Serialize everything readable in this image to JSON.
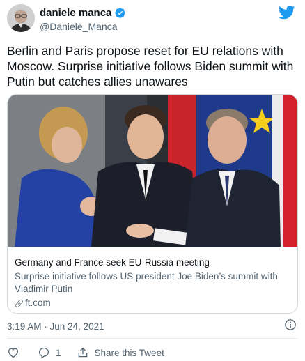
{
  "author": {
    "display_name": "daniele manca",
    "handle": "@Daniele_Manca",
    "verified": true
  },
  "tweet": {
    "text": "Berlin and Paris propose reset for EU relations with Moscow. Surprise initiative follows Biden summit with Putin but catches allies unawares"
  },
  "card": {
    "title": "Germany and France seek EU-Russia meeting",
    "description": "Surprise initiative follows US president Joe Biden’s summit with Vladimir Putin",
    "domain": "ft.com",
    "image_alt_icon": "photo-merkel-macron-putin"
  },
  "meta": {
    "timestamp": "3:19 AM · Jun 24, 2021"
  },
  "actions": {
    "reply_count": "1",
    "share_label": "Share this Tweet"
  },
  "colors": {
    "brand": "#1d9bf0",
    "text_primary": "#0f1419",
    "text_secondary": "#536471",
    "border": "#cfd9de"
  }
}
